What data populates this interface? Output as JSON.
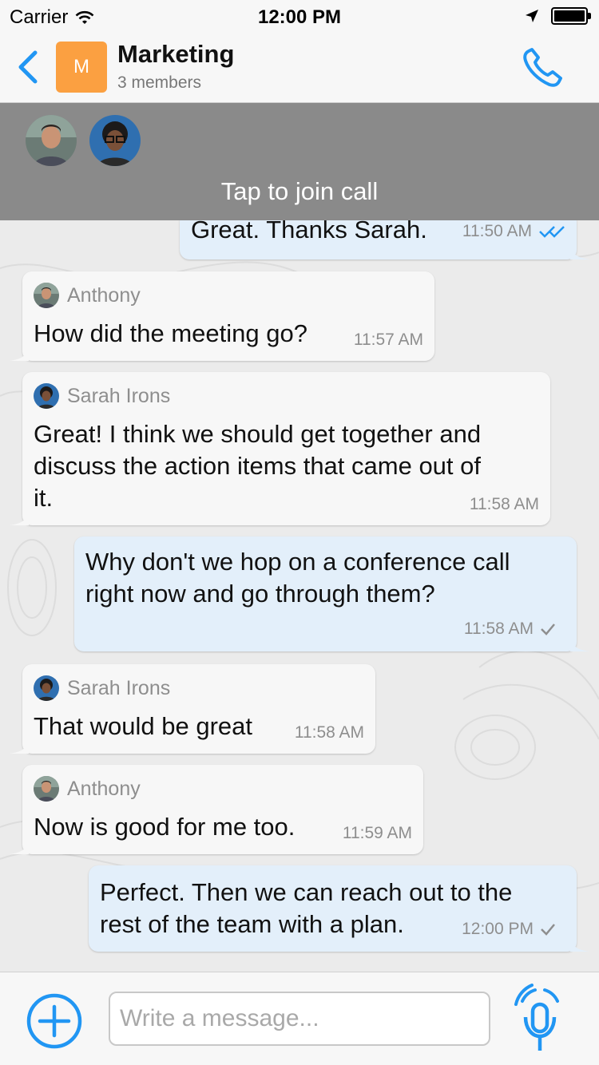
{
  "status_bar": {
    "carrier": "Carrier",
    "time": "12:00 PM"
  },
  "header": {
    "avatar_letter": "M",
    "title": "Marketing",
    "subtitle": "3 members",
    "accent_color": "#2196f3",
    "avatar_color": "#fba041"
  },
  "call_banner": {
    "label": "Tap to join call",
    "participants": [
      "Anthony",
      "Sarah Irons"
    ]
  },
  "messages": [
    {
      "direction": "out",
      "text": "Great. Thanks Sarah.",
      "time": "11:50 AM",
      "status": "read-double-check"
    },
    {
      "direction": "in",
      "sender": "Anthony",
      "text": "How did the meeting go?",
      "time": "11:57 AM"
    },
    {
      "direction": "in",
      "sender": "Sarah Irons",
      "text_lines": [
        "Great! I think we should get together and",
        "discuss the action items that came out of",
        "it."
      ],
      "time": "11:58 AM"
    },
    {
      "direction": "out",
      "text_lines": [
        "Why don't we hop on a conference call",
        "right now and go through them?"
      ],
      "time": "11:58 AM",
      "status": "sent-check"
    },
    {
      "direction": "in",
      "sender": "Sarah Irons",
      "text": "That would be great",
      "time": "11:58 AM"
    },
    {
      "direction": "in",
      "sender": "Anthony",
      "text": "Now is good for me too.",
      "time": "11:59 AM"
    },
    {
      "direction": "out",
      "text_lines": [
        "Perfect. Then we can reach out to the",
        "rest of the team with a plan."
      ],
      "time": "12:00 PM",
      "status": "sent-check"
    }
  ],
  "composer": {
    "placeholder": "Write a message...",
    "value": ""
  }
}
